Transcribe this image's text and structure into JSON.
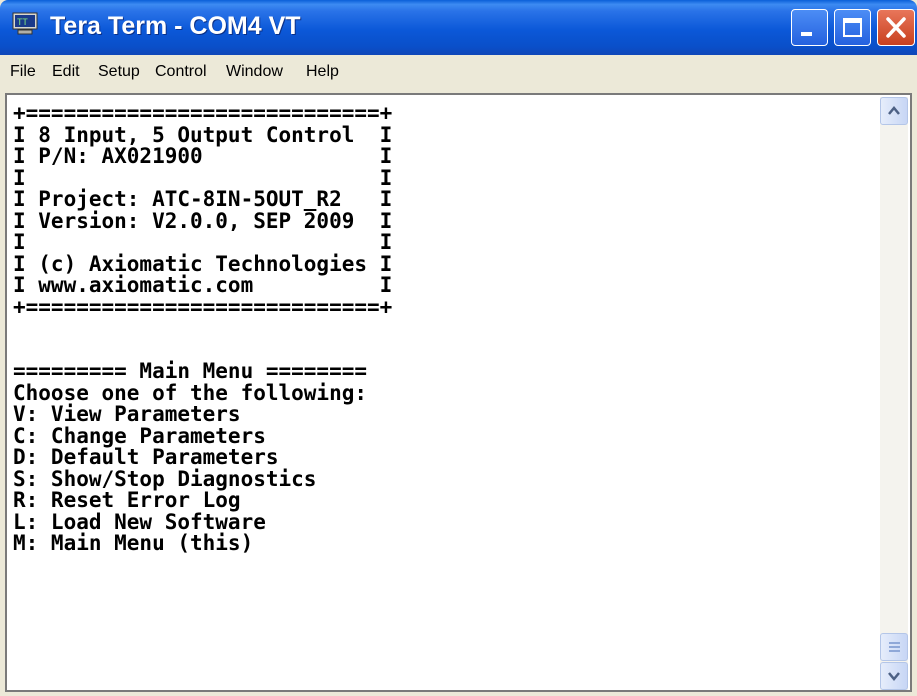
{
  "window": {
    "title": "Tera Term - COM4 VT"
  },
  "menu": {
    "items": [
      "File",
      "Edit",
      "Setup",
      "Control",
      "Window",
      "Help"
    ]
  },
  "terminal": {
    "lines": [
      "+============================+",
      "I 8 Input, 5 Output Control  I",
      "I P/N: AX021900              I",
      "I                            I",
      "I Project: ATC-8IN-5OUT_R2   I",
      "I Version: V2.0.0, SEP 2009  I",
      "I                            I",
      "I (c) Axiomatic Technologies I",
      "I www.axiomatic.com          I",
      "+============================+",
      "",
      "",
      "========= Main Menu ========",
      "Choose one of the following:",
      "V: View Parameters",
      "C: Change Parameters",
      "D: Default Parameters",
      "S: Show/Stop Diagnostics",
      "R: Reset Error Log",
      "L: Load New Software",
      "M: Main Menu (this)"
    ]
  },
  "icons": {
    "app": "terminal-icon",
    "minimize": "minimize-icon",
    "maximize": "maximize-icon",
    "close": "close-icon",
    "scroll_up": "chevron-up-icon",
    "scroll_down": "chevron-down-icon"
  },
  "colors": {
    "titlebar": "#0a4fc9",
    "close_button": "#c8401f",
    "terminal_background": "#ffffff",
    "terminal_text": "#000000"
  }
}
